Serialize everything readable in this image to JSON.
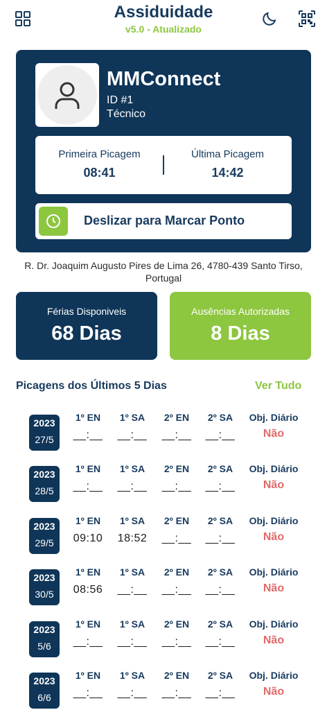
{
  "header": {
    "title": "Assiduidade",
    "version": "v5.0 - Atualizado",
    "icons": [
      "grid-icon",
      "moon-icon",
      "qr-code-icon"
    ]
  },
  "profile": {
    "name": "MMConnect",
    "id": "ID #1",
    "role": "Técnico",
    "first_punch_label": "Primeira Picagem",
    "first_punch_value": "08:41",
    "last_punch_label": "Última Picagem",
    "last_punch_value": "14:42",
    "slide_label": "Deslizar para Marcar Ponto"
  },
  "address": "R. Dr. Joaquim Augusto Pires de Lima 26, 4780-439 Santo Tirso, Portugal",
  "stats": {
    "vacation_label": "Férias Disponiveis",
    "vacation_value": "68 Dias",
    "absence_label": "Ausências Autorizadas",
    "absence_value": "8 Dias"
  },
  "section": {
    "title": "Picagens dos Últimos 5 Dias",
    "see_all": "Ver Tudo"
  },
  "columns": {
    "en1": "1º EN",
    "sa1": "1º SA",
    "en2": "2º EN",
    "sa2": "2º SA",
    "objective": "Obj. Diário"
  },
  "rows": [
    {
      "year": "2023",
      "day": "27/5",
      "en1": "__:__",
      "sa1": "__:__",
      "en2": "__:__",
      "sa2": "__:__",
      "objective": "Não"
    },
    {
      "year": "2023",
      "day": "28/5",
      "en1": "__:__",
      "sa1": "__:__",
      "en2": "__:__",
      "sa2": "__:__",
      "objective": "Não"
    },
    {
      "year": "2023",
      "day": "29/5",
      "en1": "09:10",
      "sa1": "18:52",
      "en2": "__:__",
      "sa2": "__:__",
      "objective": "Não"
    },
    {
      "year": "2023",
      "day": "30/5",
      "en1": "08:56",
      "sa1": "__:__",
      "en2": "__:__",
      "sa2": "__:__",
      "objective": "Não"
    },
    {
      "year": "2023",
      "day": "5/6",
      "en1": "__:__",
      "sa1": "__:__",
      "en2": "__:__",
      "sa2": "__:__",
      "objective": "Não"
    },
    {
      "year": "2023",
      "day": "6/6",
      "en1": "__:__",
      "sa1": "__:__",
      "en2": "__:__",
      "sa2": "__:__",
      "objective": "Não"
    }
  ],
  "colors": {
    "navy": "#0f3558",
    "green": "#8dc63f",
    "red": "#e06a6a"
  }
}
